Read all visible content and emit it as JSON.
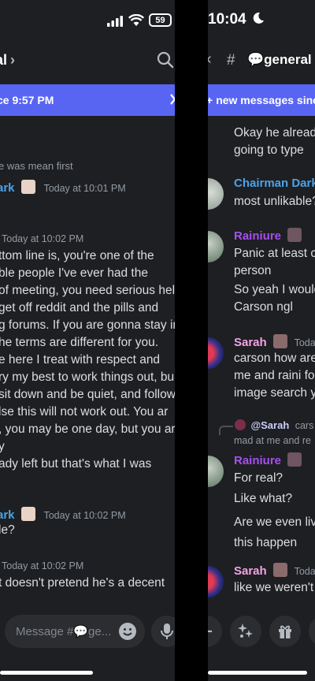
{
  "status": {
    "time": "10:04",
    "battery": "59"
  },
  "left": {
    "header": {
      "channel": "al",
      "chevron": "›"
    },
    "banner": {
      "text": "ce 9:57 PM"
    },
    "reply_snippet": "e was mean first",
    "msg1": {
      "author": "ark",
      "timestamp": "Today at 10:01 PM"
    },
    "msg2": {
      "timestamp": "Today at 10:02 PM",
      "lines": [
        "ttom line is, you're one of the",
        "ble people I've ever had the",
        "of meeting, you need serious help",
        "get off reddit and the pills and",
        "g forums. If you are gonna stay in",
        "he terms are different for you.",
        "e here I treat with respect and",
        "ry my best to work things out, bu",
        "sit down and be quiet, and follow",
        "lse this will not work out. You ar",
        ", you may be one day, but you ar",
        "y"
      ]
    },
    "msg2b": "ady left but that's what I was",
    "msg3": {
      "author": "ark",
      "timestamp": "Today at 10:02 PM",
      "text": "le?"
    },
    "msg4": {
      "timestamp": "Today at 10:02 PM",
      "text": "t doesn't pretend he's a decent"
    },
    "composer": {
      "placeholder": "Message #💬ge..."
    }
  },
  "right": {
    "header": {
      "back": "‹",
      "hash": "#",
      "channel": "💬general"
    },
    "banner": {
      "text": "new messages since"
    },
    "top_lines": [
      "Okay he alread",
      "going to type"
    ],
    "chairman": {
      "author": "Chairman Dark",
      "text": "most unlikable?"
    },
    "rainiure1": {
      "author": "Rainiure",
      "lines": [
        "Panic at least c",
        "person"
      ],
      "more": [
        "So yeah I would",
        "Carson ngl"
      ]
    },
    "sarah1": {
      "author": "Sarah",
      "timestamp": "Today",
      "lines": [
        "carson how are",
        "me and raini fo",
        "image search yo"
      ]
    },
    "reply": {
      "mention": "@Sarah",
      "rest": "cars",
      "line2": "mad at me and re"
    },
    "rainiure2": {
      "author": "Rainiure",
      "lines": [
        "For real?",
        "Like what?",
        "Are we even liv",
        "this happen"
      ]
    },
    "sarah2": {
      "author": "Sarah",
      "timestamp": "Today",
      "text": "like we weren't"
    }
  },
  "colors": {
    "bg": "#1e1f22",
    "blurple": "#5865f2",
    "author_blue": "#4ba3e8",
    "author_purple": "#a64ff0",
    "author_pink": "#f3a4e6",
    "text": "#dbdee1",
    "muted": "#949ba4"
  },
  "icons": [
    "signal-icon",
    "wifi-icon",
    "battery-icon",
    "moon-icon",
    "search-icon",
    "close-icon",
    "emoji-icon",
    "mic-icon",
    "plus-icon",
    "sparkle-icon",
    "gift-icon",
    "hash-icon"
  ]
}
